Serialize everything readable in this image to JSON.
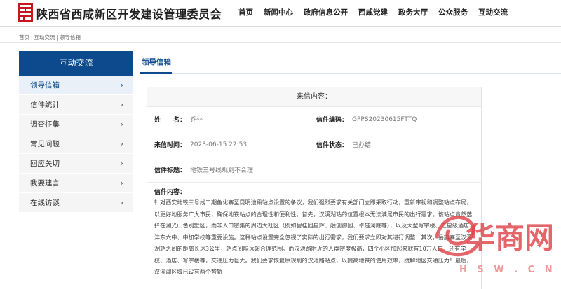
{
  "header": {
    "site_title": "陕西省西咸新区开发建设管理委员会",
    "nav": [
      "首页",
      "新闻中心",
      "政府信息公开",
      "西咸党建",
      "政务大厅",
      "公众服务",
      "互动交流"
    ]
  },
  "breadcrumb": [
    "首页",
    "互动交流",
    "领导信箱"
  ],
  "sidebar": {
    "title": "互动交流",
    "items": [
      {
        "label": "领导信箱",
        "active": true
      },
      {
        "label": "信件统计"
      },
      {
        "label": "调查征集"
      },
      {
        "label": "常见问题"
      },
      {
        "label": "回应关切"
      },
      {
        "label": "我要建言"
      },
      {
        "label": "在线访谈"
      }
    ],
    "chevron": "›"
  },
  "content": {
    "tab": "领导信箱"
  },
  "letter": {
    "header": "来信内容：",
    "name_label": "姓　　名：",
    "name_value": "乔**",
    "code_label": "信件编码：",
    "code_value": "GPPS20230615FTTQ",
    "time_label": "来信时间：",
    "time_value": "2023-06-15 22:53",
    "status_label": "信件状态：",
    "status_value": "已办结",
    "subject_label": "信件标题：",
    "subject_value": "地铁三号线规划不合理",
    "body_label": "信件内容：",
    "body": "针对西安地铁三号线二期鱼化寨至昆明池段站点设置的争议，我们强烈要求有关部门立即采取行动，重新审视和调整站点布局，以更好地服务广大市民，确保地铁站点的合理性和便利性。首先，汉溪湖站的位置根本无法满足市民的出行需求。该站点竟然选择在湖光山色别墅区，而非人口密集的周边大社区（例如碧桂园星辉、融创御园、卓越澜庭等），以及大型写字楼、五星级酒店、沣东六中、中加学校等重要设施。这种站点设置完全忽视了实际的出行需求，我们要求立即对其进行调整！其次，岳旗寨至汉溪湖站之间的距离长达3公里，站点间隔远超合理范围。而汉池路附近的人群密度极高，四个小区加起来就有10万人口，还有学校、酒店、写字楼等，交通压力巨大。我们要求恢复原规划的汉池路站点，以提高地铁的使用效率，缓解地区交通压力！最后，汉溪湖区域已设有两个智轨"
  },
  "watermark": {
    "logo_text": "华商网",
    "url": "H S W . C N"
  },
  "colors": {
    "primary": "#0d4a8d",
    "sidebar_bg": "#f5f5f5",
    "watermark": "#e0454a"
  }
}
